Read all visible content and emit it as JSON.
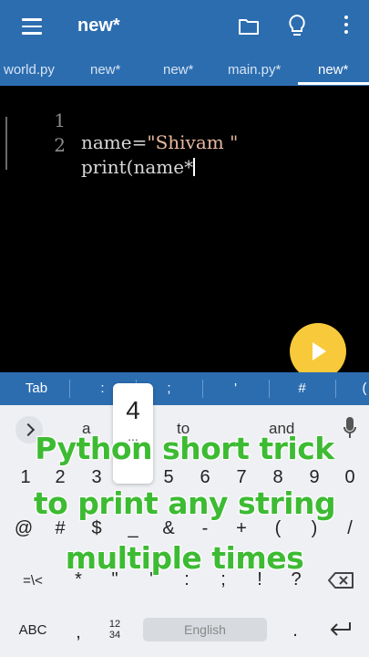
{
  "appbar": {
    "title": "new*"
  },
  "tabs": [
    "world.py",
    "new*",
    "new*",
    "main.py*",
    "new*"
  ],
  "editor": {
    "lines": [
      {
        "num": "1",
        "pre": "name=",
        "str": "\"Shivam \""
      },
      {
        "num": "2",
        "pre": "print(name*",
        "str": ""
      }
    ]
  },
  "symbols": [
    "Tab",
    ":",
    ";",
    "'",
    "#",
    "("
  ],
  "keyboard": {
    "suggestions": [
      "a",
      "to",
      "and"
    ],
    "popup": {
      "key": "4",
      "more": "..."
    },
    "row_numbers": [
      "1",
      "2",
      "3",
      "4",
      "5",
      "6",
      "7",
      "8",
      "9",
      "0"
    ],
    "row_symbols": [
      "@",
      "#",
      "$",
      "_",
      "&",
      "-",
      "+",
      "(",
      ")",
      "/"
    ],
    "row_punct": [
      "=\\<",
      "*",
      "\"",
      "'",
      ":",
      ";",
      "!",
      "?"
    ],
    "bottom": {
      "abc": "ABC",
      "comma": ",",
      "numpad": "12\n34",
      "space": "English",
      "period": "."
    }
  },
  "caption": [
    "Python short trick",
    "to print any string",
    "multiple times"
  ],
  "colors": {
    "bar": "#2c6db0",
    "run": "#f8c93a",
    "caption": "#3dbb33"
  }
}
